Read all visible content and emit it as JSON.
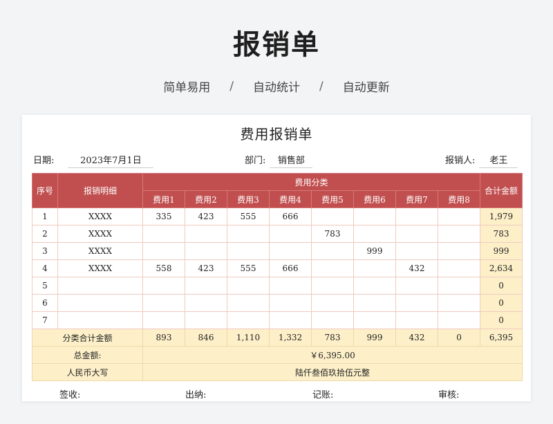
{
  "header": {
    "title": "报销单",
    "taglines": [
      "简单易用",
      "自动统计",
      "自动更新"
    ],
    "separator": "/"
  },
  "form": {
    "title": "费用报销单",
    "date_label": "日期:",
    "date_value": "2023年7月1日",
    "dept_label": "部门:",
    "dept_value": "销售部",
    "person_label": "报销人:",
    "person_value": "老王"
  },
  "table": {
    "col_seq": "序号",
    "col_detail": "报销明细",
    "col_category": "费用分类",
    "col_total": "合计金额",
    "fee_headers": [
      "费用1",
      "费用2",
      "费用3",
      "费用4",
      "费用5",
      "费用6",
      "费用7",
      "费用8"
    ],
    "rows": [
      {
        "seq": "1",
        "detail": "XXXX",
        "fees": [
          "335",
          "423",
          "555",
          "666",
          "",
          "",
          "",
          ""
        ],
        "total": "1,979"
      },
      {
        "seq": "2",
        "detail": "XXXX",
        "fees": [
          "",
          "",
          "",
          "",
          "783",
          "",
          "",
          ""
        ],
        "total": "783"
      },
      {
        "seq": "3",
        "detail": "XXXX",
        "fees": [
          "",
          "",
          "",
          "",
          "",
          "999",
          "",
          ""
        ],
        "total": "999"
      },
      {
        "seq": "4",
        "detail": "XXXX",
        "fees": [
          "558",
          "423",
          "555",
          "666",
          "",
          "",
          "432",
          ""
        ],
        "total": "2,634"
      },
      {
        "seq": "5",
        "detail": "",
        "fees": [
          "",
          "",
          "",
          "",
          "",
          "",
          "",
          ""
        ],
        "total": "0"
      },
      {
        "seq": "6",
        "detail": "",
        "fees": [
          "",
          "",
          "",
          "",
          "",
          "",
          "",
          ""
        ],
        "total": "0"
      },
      {
        "seq": "7",
        "detail": "",
        "fees": [
          "",
          "",
          "",
          "",
          "",
          "",
          "",
          ""
        ],
        "total": "0"
      }
    ],
    "sum_label": "分类合计金额",
    "sum_values": [
      "893",
      "846",
      "1,110",
      "1,332",
      "783",
      "999",
      "432",
      "0"
    ],
    "sum_total": "6,395",
    "grand_label": "总金额:",
    "grand_value": "￥6,395.00",
    "rmb_label": "人民币大写",
    "rmb_value": "陆仟叁佰玖拾伍元整"
  },
  "signatures": [
    "签收:",
    "出纳:",
    "记账:",
    "审核:"
  ]
}
